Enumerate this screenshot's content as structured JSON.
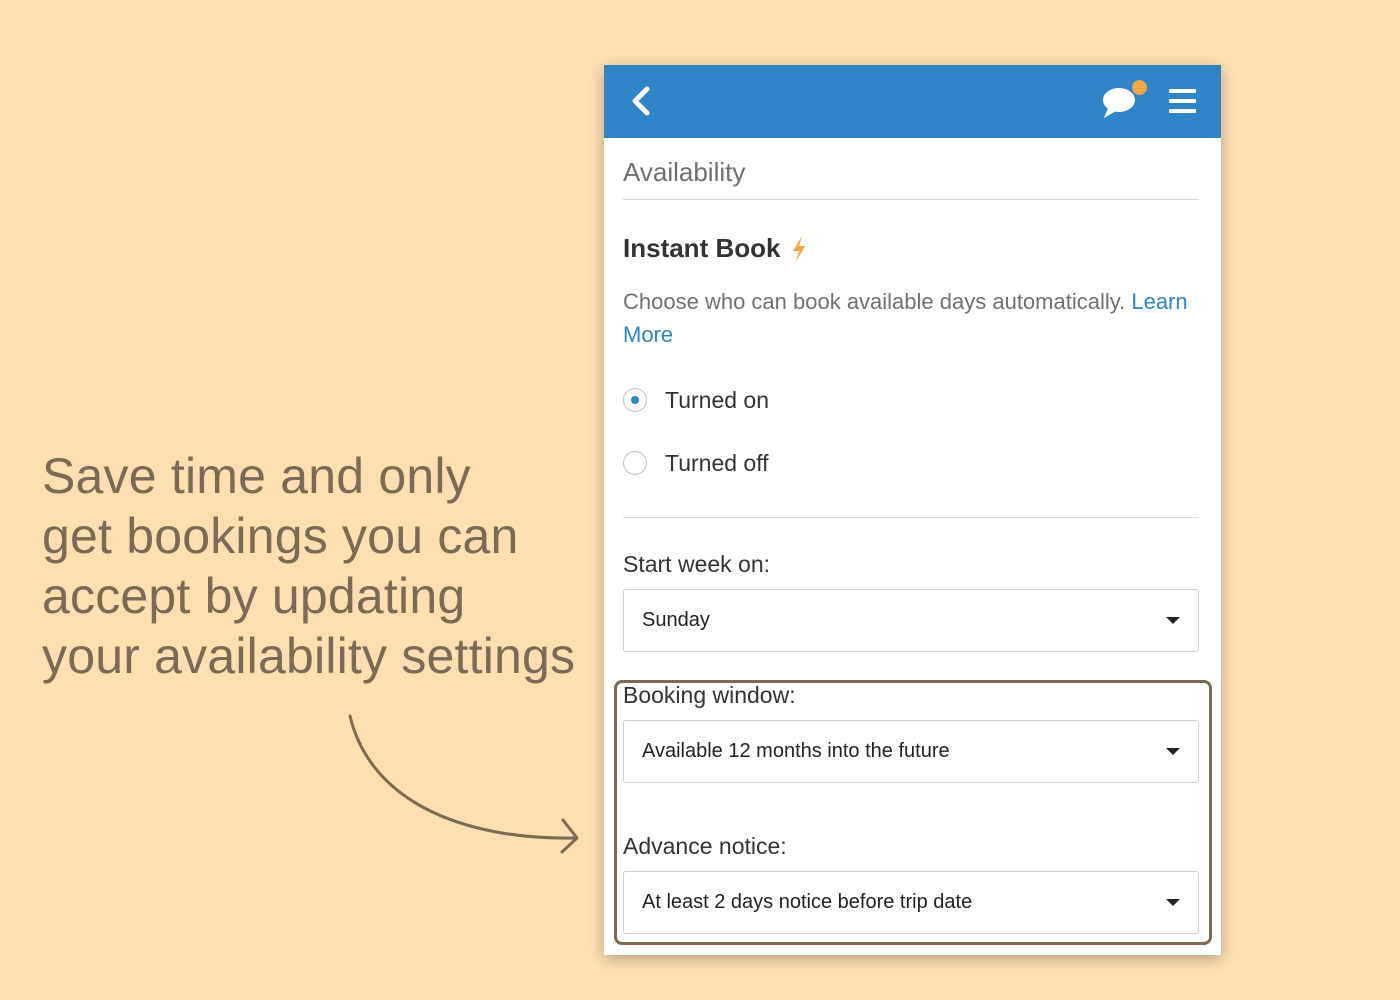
{
  "caption": {
    "lines": [
      "Save time and only",
      "get bookings you can",
      "accept by updating",
      "your availability settings"
    ]
  },
  "header": {
    "back_icon": "chevron-left-icon",
    "chat_icon": "chat-bubble-icon",
    "menu_icon": "hamburger-menu-icon",
    "notification_color": "#f0a546",
    "brand_color": "#2f84c6"
  },
  "page": {
    "title": "Availability"
  },
  "instant_book": {
    "heading": "Instant Book",
    "bolt_icon": "lightning-bolt-icon",
    "description": "Choose who can book available days automatically.",
    "learn_more": "Learn More",
    "options": [
      {
        "label": "Turned on",
        "checked": true
      },
      {
        "label": "Turned off",
        "checked": false
      }
    ]
  },
  "start_week": {
    "label": "Start week on:",
    "value": "Sunday"
  },
  "booking_window": {
    "label": "Booking window:",
    "value": "Available 12 months into the future"
  },
  "advance_notice": {
    "label": "Advance notice:",
    "value": "At least 2 days notice before trip date"
  }
}
